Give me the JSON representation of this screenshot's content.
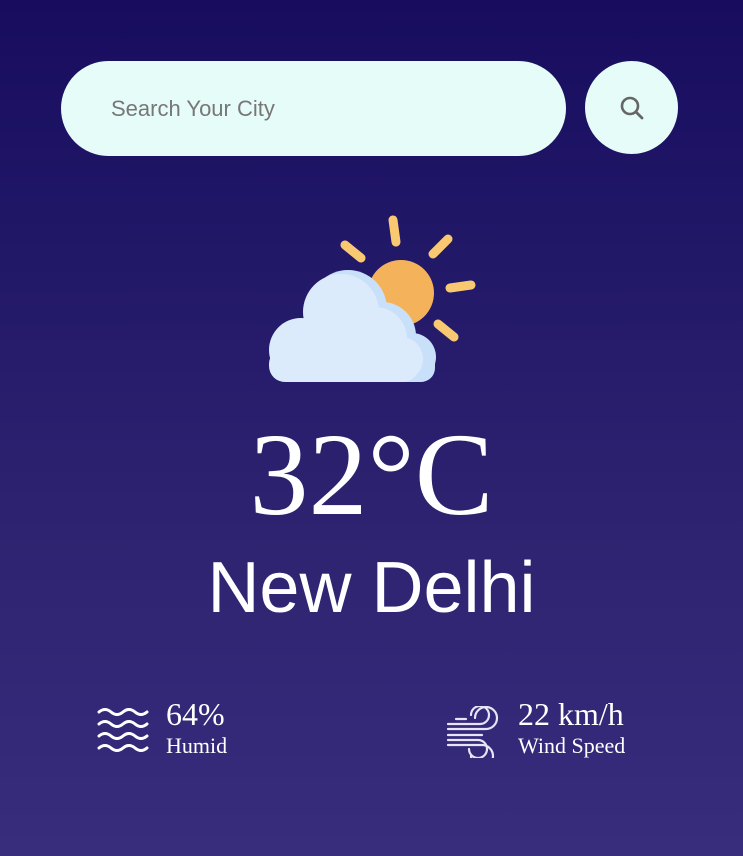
{
  "search": {
    "placeholder": "Search Your City",
    "icon": "search-icon"
  },
  "weather": {
    "icon": "partly-cloudy-icon",
    "temperature": "32°C",
    "city": "New Delhi"
  },
  "stats": {
    "humidity": {
      "icon": "humidity-waves-icon",
      "value": "64%",
      "label": "Humid"
    },
    "wind": {
      "icon": "wind-icon",
      "value": "22 km/h",
      "label": "Wind Speed"
    }
  },
  "colors": {
    "background_top": "#170c5e",
    "background_bottom": "#382c7d",
    "search_fill": "#e6fcf8",
    "sun": "#f4b25a",
    "sun_rays": "#f9c972",
    "cloud": "#dcebfb"
  }
}
